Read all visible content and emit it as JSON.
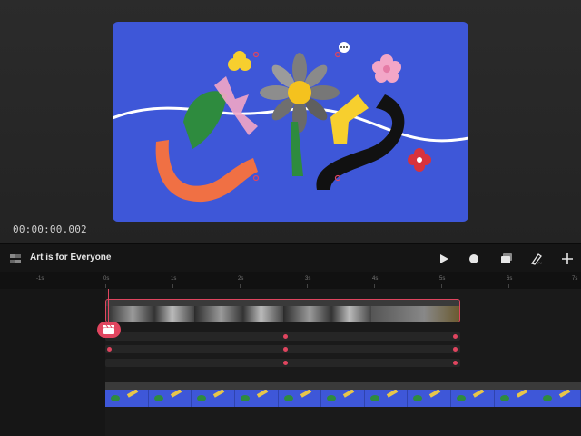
{
  "preview": {
    "timecode": "00:00:00.002",
    "canvas_color": "#3e57d8"
  },
  "toolbar": {
    "project_title": "Art is for Everyone",
    "icons": [
      "layers-icon",
      "play-icon",
      "record-icon",
      "clip-stack-icon",
      "draw-pen-icon",
      "add-icon"
    ]
  },
  "ruler": {
    "labels": [
      "-1s",
      "0s",
      "1s",
      "2s",
      "3s",
      "4s",
      "5s",
      "6s",
      "7s"
    ]
  },
  "colors": {
    "accent": "#e0455f",
    "background": "#111111"
  }
}
